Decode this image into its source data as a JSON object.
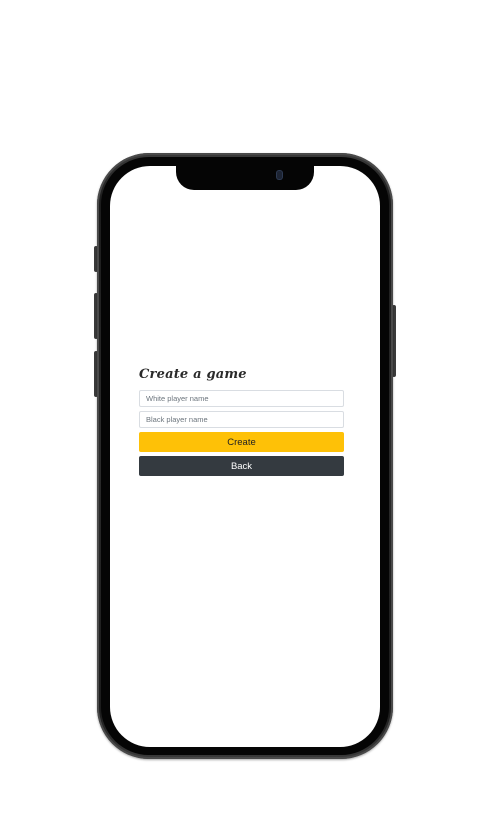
{
  "form": {
    "title": "Create a game",
    "white_player": {
      "value": "",
      "placeholder": "White player name"
    },
    "black_player": {
      "value": "",
      "placeholder": "Black player name"
    },
    "create_label": "Create",
    "back_label": "Back"
  },
  "colors": {
    "create_button": "#fec107",
    "back_button": "#343a40",
    "phone_frame": "#1c1c1c",
    "screen_background": "#ffffff"
  }
}
